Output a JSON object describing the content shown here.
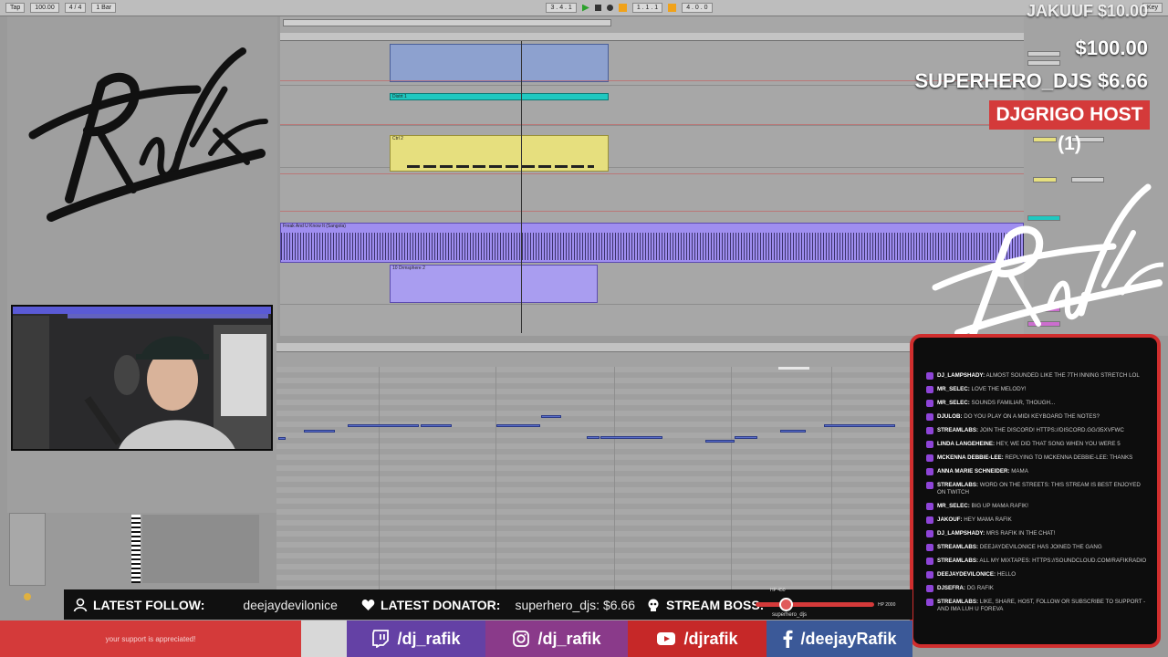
{
  "overlay": {
    "top_donation": "JAKUUF $10.00",
    "donation_2": "$100.00",
    "donation_3": "SUPERHERO_DJS  $6.66",
    "host": "DJGRIGO  HOST (1)"
  },
  "arrangement": {
    "tracks": [
      {
        "clip": ""
      },
      {
        "clip": "Distrt 1"
      },
      {
        "clip": "Ctrl 2"
      },
      {
        "clip": "Freak And U Know It (Sangola)"
      },
      {
        "clip": "10 Drmsphere 2"
      }
    ]
  },
  "chat": [
    {
      "user": "DJ_LAMPSHADY:",
      "text": "ALMOST SOUNDED LIKE THE 7TH INNING STRETCH LOL"
    },
    {
      "user": "MR_SELEC:",
      "text": "LOVE THE MELODY!"
    },
    {
      "user": "MR_SELEC:",
      "text": "SOUNDS FAMILIAR, THOUGH..."
    },
    {
      "user": "DJULOB:",
      "text": "DO YOU PLAY ON A MIDI KEYBOARD THE NOTES?"
    },
    {
      "user": "STREAMLABS:",
      "text": "JOIN THE DISCORD! HTTPS://DISCORD.GG/35XVFWC"
    },
    {
      "user": "LINDA LANGEHEINE:",
      "text": "HEY, WE DID THAT SONG WHEN YOU WERE 5"
    },
    {
      "user": "MCKENNA DEBBIE-LEE:",
      "text": "REPLYING TO MCKENNA DEBBIE-LEE: THANKS"
    },
    {
      "user": "ANNA MARIE SCHNEIDER:",
      "text": "MAMA"
    },
    {
      "user": "STREAMLABS:",
      "text": "WORD ON THE STREETS: THIS STREAM IS BEST ENJOYED ON TWITCH"
    },
    {
      "user": "MR_SELEC:",
      "text": "BIG UP MAMA RAFIK!"
    },
    {
      "user": "JAKOUF:",
      "text": "HEY MAMA RAFIK"
    },
    {
      "user": "DJ_LAMPSHADY:",
      "text": "MRS RAFIK IN THE CHAT!"
    },
    {
      "user": "STREAMLABS:",
      "text": "DEEJAYDEVILONICE HAS JOINED THE GANG"
    },
    {
      "user": "STREAMLABS:",
      "text": "ALL MY MIXTAPES: HTTPS://SOUNDCLOUD.COM/RAFIKRADIO"
    },
    {
      "user": "DEEJAYDEVILONICE:",
      "text": "HELLO"
    },
    {
      "user": "DJSEFRA:",
      "text": "DG RAFIK"
    },
    {
      "user": "STREAMLABS:",
      "text": "LIKE, SHARE, HOST, FOLLOW OR SUBSCRIBE TO SUPPORT - AND IMA LUH U FOREVA"
    }
  ],
  "infobar": {
    "follow_label": "LATEST FOLLOW:",
    "follow_value": "deejaydevilonice",
    "donator_label": "LATEST DONATOR:",
    "donator_value": "superhero_djs: $6.66",
    "boss_label": "STREAM BOSS:",
    "boss_name": "superhero_djs",
    "boss_min": "HP 450",
    "boss_max": "HP 2000"
  },
  "social": {
    "support": "your support is appreciated!",
    "twitch": "/dj_rafik",
    "instagram": "/dj_rafik",
    "youtube": "/djrafik",
    "facebook": "/deejayRafik"
  },
  "colors": {
    "accent_red": "#d43a3a",
    "twitch": "#6441a5",
    "instagram": "#8a3a8a",
    "youtube": "#c62828",
    "facebook": "#3b5998",
    "clip_cyan": "#1fc8c0",
    "clip_yellow": "#e6df7e",
    "clip_purple": "#9f8ef0"
  }
}
